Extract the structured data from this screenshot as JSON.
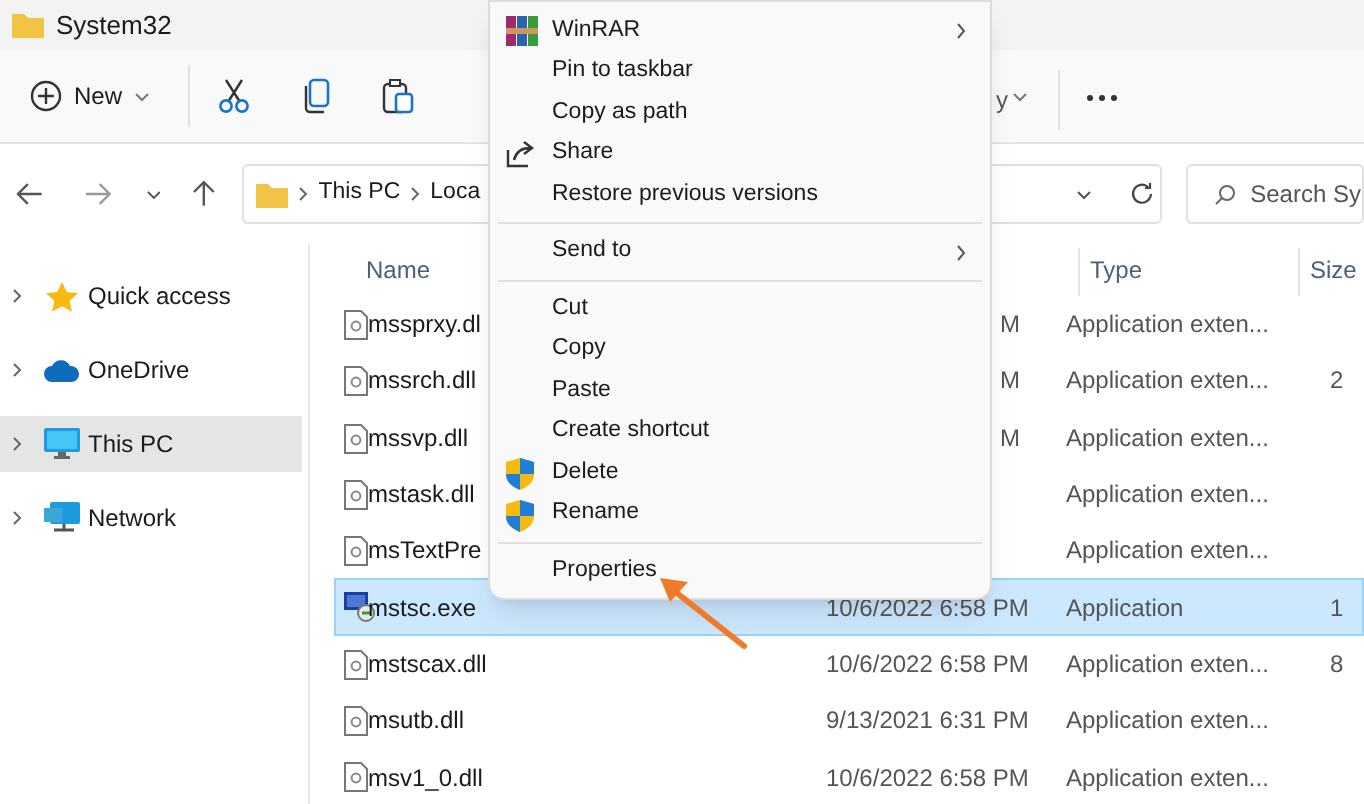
{
  "window": {
    "title": "System32"
  },
  "toolbar": {
    "new_label": "New",
    "partial_label": "y"
  },
  "address_bar": {
    "crumbs": [
      "This PC",
      "Loca"
    ]
  },
  "search": {
    "placeholder": "Search Sy"
  },
  "sidebar": {
    "items": [
      {
        "label": "Quick access",
        "kind": "star",
        "selected": false
      },
      {
        "label": "OneDrive",
        "kind": "cloud",
        "selected": false
      },
      {
        "label": "This PC",
        "kind": "pc",
        "selected": true
      },
      {
        "label": "Network",
        "kind": "network",
        "selected": false
      }
    ]
  },
  "file_list": {
    "columns": {
      "name": "Name",
      "type": "Type",
      "size": "Size"
    },
    "rows": [
      {
        "name": "mssprxy.dl",
        "kind": "dll",
        "date": "M",
        "type": "Application exten...",
        "selected": false
      },
      {
        "name": "mssrch.dll",
        "kind": "dll",
        "date": "M",
        "type": "Application exten...",
        "size": "2",
        "selected": false
      },
      {
        "name": "mssvp.dll",
        "kind": "dll",
        "date": "M",
        "type": "Application exten...",
        "selected": false
      },
      {
        "name": "mstask.dll",
        "kind": "dll",
        "type": "Application exten...",
        "selected": false
      },
      {
        "name": "msTextPre",
        "kind": "dll",
        "type": "Application exten...",
        "selected": false
      },
      {
        "name": "mstsc.exe",
        "kind": "exe",
        "date": "10/6/2022 6:58 PM",
        "type": "Application",
        "size": "1",
        "selected": true
      },
      {
        "name": "mstscax.dll",
        "kind": "dll",
        "date": "10/6/2022 6:58 PM",
        "type": "Application exten...",
        "size": "8",
        "selected": false
      },
      {
        "name": "msutb.dll",
        "kind": "dll",
        "date": "9/13/2021 6:31 PM",
        "type": "Application exten...",
        "selected": false
      },
      {
        "name": "msv1_0.dll",
        "kind": "dll",
        "date": "10/6/2022 6:58 PM",
        "type": "Application exten...",
        "selected": false
      }
    ]
  },
  "context_menu": {
    "items": [
      {
        "kind": "winrar",
        "label": "WinRAR",
        "submenu": true
      },
      {
        "kind": "item",
        "label": "Pin to taskbar"
      },
      {
        "kind": "item",
        "label": "Copy as path"
      },
      {
        "kind": "share",
        "label": "Share"
      },
      {
        "kind": "item",
        "label": "Restore previous versions"
      },
      {
        "kind": "separator"
      },
      {
        "kind": "item",
        "label": "Send to",
        "submenu": true
      },
      {
        "kind": "separator"
      },
      {
        "kind": "item",
        "label": "Cut"
      },
      {
        "kind": "item",
        "label": "Copy"
      },
      {
        "kind": "item",
        "label": "Paste"
      },
      {
        "kind": "item",
        "label": "Create shortcut"
      },
      {
        "kind": "shield",
        "label": "Delete"
      },
      {
        "kind": "shield",
        "label": "Rename"
      },
      {
        "kind": "separator"
      },
      {
        "kind": "item",
        "label": "Properties"
      }
    ]
  }
}
